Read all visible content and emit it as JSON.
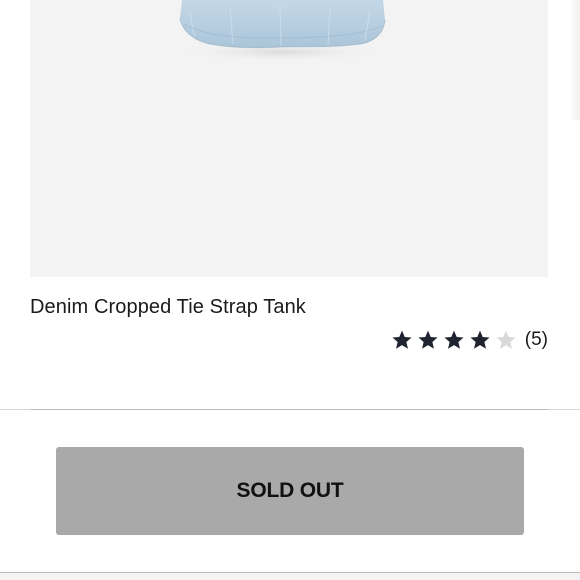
{
  "product": {
    "image_alt": "Denim Cropped Tie Strap Tank",
    "title": "Denim Cropped Tie Strap Tank",
    "rating": {
      "value": 4,
      "max": 5,
      "count_label": "(5)"
    }
  },
  "actions": {
    "sold_out_label": "SOLD OUT"
  },
  "colors": {
    "image_background": "#f3f3f3",
    "denim": "#bcd3e3",
    "star_filled": "#1f2430",
    "star_empty": "#d9d9d9",
    "button_disabled": "#a9a9a9"
  }
}
